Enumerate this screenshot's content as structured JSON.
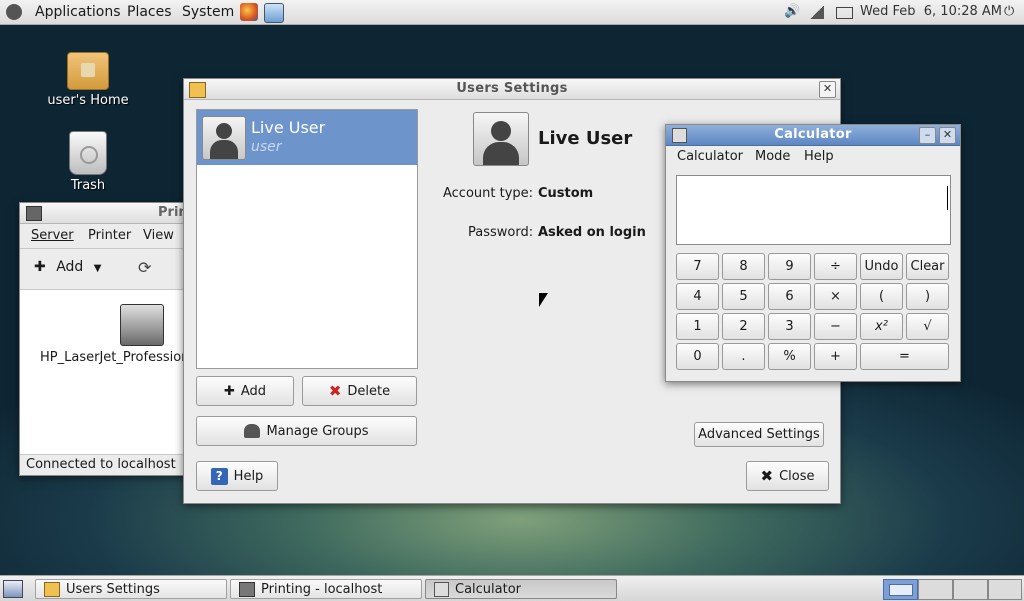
{
  "top_panel": {
    "menus": [
      "Applications",
      "Places",
      "System"
    ],
    "clock": "Wed Feb  6, 10:28 AM",
    "launchers": [
      "firefox-icon",
      "mail-icon"
    ]
  },
  "desktop": {
    "icons": [
      {
        "label": "user's Home",
        "icon": "home-folder-icon"
      },
      {
        "label": "Trash",
        "icon": "trash-icon"
      }
    ]
  },
  "printing_window": {
    "title": "Printing - localhost",
    "title_visible": "Prin",
    "menus": [
      "Server",
      "Printer",
      "View"
    ],
    "add_label": "Add",
    "printer_name": "HP_LaserJet_Professional",
    "status": "Connected to localhost"
  },
  "users_window": {
    "title": "Users Settings",
    "user_list": [
      {
        "name": "Live User",
        "login": "user"
      }
    ],
    "detail_name": "Live User",
    "account_type_label": "Account type:",
    "account_type_value": "Custom",
    "password_label": "Password:",
    "password_value": "Asked on login",
    "buttons": {
      "add": "Add",
      "delete": "Delete",
      "manage_groups": "Manage Groups",
      "help": "Help",
      "advanced": "Advanced Settings",
      "close": "Close"
    }
  },
  "calculator": {
    "title": "Calculator",
    "menus": [
      "Calculator",
      "Mode",
      "Help"
    ],
    "display": "",
    "keys": [
      [
        "7",
        "8",
        "9",
        "÷",
        "Undo",
        "Clear"
      ],
      [
        "4",
        "5",
        "6",
        "×",
        "(",
        ")"
      ],
      [
        "1",
        "2",
        "3",
        "−",
        "x²",
        "√"
      ],
      [
        "0",
        ".",
        "%",
        "+",
        "="
      ]
    ]
  },
  "taskbar": {
    "tasks": [
      {
        "label": "Users Settings",
        "active": false
      },
      {
        "label": "Printing - localhost",
        "active": false
      },
      {
        "label": "Calculator",
        "active": true
      }
    ],
    "workspaces": 4
  },
  "colors": {
    "selection": "#6d95cc",
    "delete_red": "#cc2222",
    "help_blue": "#3466b8"
  }
}
